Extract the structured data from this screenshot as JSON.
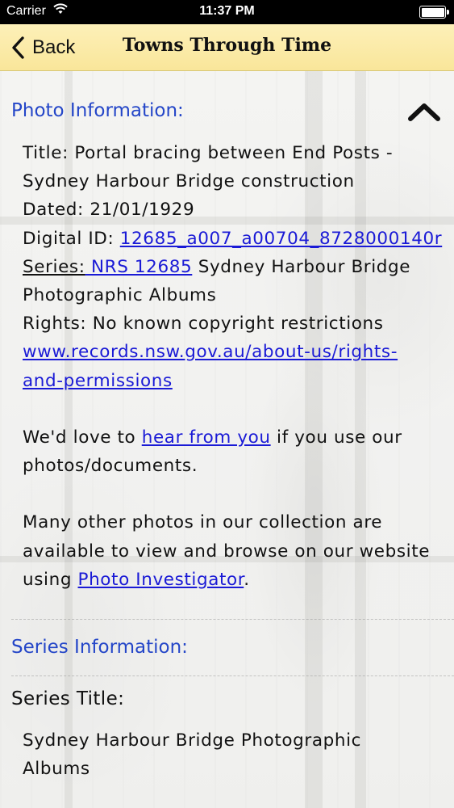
{
  "status_bar": {
    "carrier": "Carrier",
    "time": "11:37 PM"
  },
  "nav": {
    "back_label": "Back",
    "title": "Towns Through Time"
  },
  "photo_info": {
    "header": "Photo Information:",
    "title_line1": "Title: Portal bracing between End Posts -",
    "title_line2": "Sydney Harbour Bridge construction",
    "dated": "Dated: 21/01/1929",
    "digital_id_label": "Digital ID: ",
    "digital_id_link": "12685_a007_a00704_8728000140r",
    "series_label": "Series:",
    "series_link": " NRS 12685",
    "series_rest": " Sydney Harbour Bridge",
    "series_line2": "Photographic Albums",
    "rights": "Rights: No known copyright restrictions",
    "rights_link_line1": "www.records.nsw.gov.au/about-us/rights-",
    "rights_link_line2": "and-permissions",
    "feedback_pre": "We'd love to ",
    "feedback_link": "hear from you",
    "feedback_post": " if you use our",
    "feedback_line2": "photos/documents.",
    "collection_line1": "Many other photos in our collection are",
    "collection_line2": "available to view and browse on our website",
    "collection_pre": "using ",
    "collection_link": "Photo Investigator",
    "collection_post": "."
  },
  "series_info": {
    "header": "Series Information:",
    "series_title_label": "Series Title:",
    "series_title_line1": "Sydney Harbour Bridge Photographic",
    "series_title_line2": "Albums"
  },
  "colors": {
    "nav_background": "#f9e69a",
    "section_header": "#2446c8",
    "link": "#1a1ad6"
  }
}
